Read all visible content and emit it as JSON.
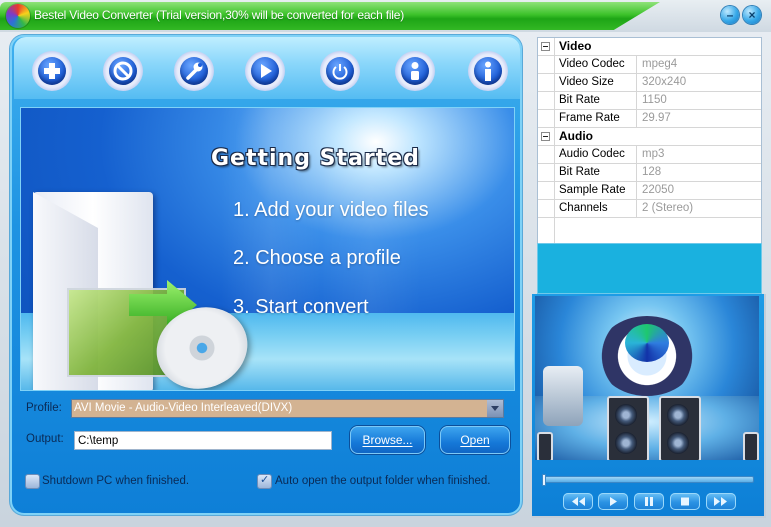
{
  "window": {
    "title": "Bestel Video Converter  (Trial version,30% will be converted for each file)",
    "minimize_glyph": "–",
    "close_glyph": "×"
  },
  "toolbar": {
    "buttons": [
      {
        "name": "add-files",
        "icon": "plus-icon"
      },
      {
        "name": "remove",
        "icon": "prohibit-icon"
      },
      {
        "name": "settings",
        "icon": "wrench-icon"
      },
      {
        "name": "convert",
        "icon": "play-icon"
      },
      {
        "name": "stop",
        "icon": "power-icon"
      },
      {
        "name": "about",
        "icon": "person-icon"
      },
      {
        "name": "info",
        "icon": "info-icon"
      }
    ]
  },
  "banner": {
    "title": "Getting Started",
    "steps": [
      "1. Add your video files",
      "2. Choose a profile",
      "3. Start convert"
    ]
  },
  "form": {
    "profile_label": "Profile:",
    "profile_value": "AVI Movie - Audio-Video Interleaved(DIVX)",
    "output_label": "Output:",
    "output_value": "C:\\temp",
    "browse_label": "Browse...",
    "open_label": "Open",
    "shutdown_label": "Shutdown PC when finished.",
    "shutdown_checked": false,
    "autoopen_label": "Auto open the output folder when finished.",
    "autoopen_checked": true
  },
  "properties": {
    "video": {
      "group": "Video",
      "rows": [
        {
          "name": "Video Codec",
          "value": "mpeg4"
        },
        {
          "name": "Video Size",
          "value": "320x240"
        },
        {
          "name": "Bit Rate",
          "value": "1150"
        },
        {
          "name": "Frame Rate",
          "value": "29.97"
        }
      ]
    },
    "audio": {
      "group": "Audio",
      "rows": [
        {
          "name": "Audio Codec",
          "value": "mp3"
        },
        {
          "name": "Bit Rate",
          "value": "128"
        },
        {
          "name": "Sample Rate",
          "value": "22050"
        },
        {
          "name": "Channels",
          "value": "2 (Stereo)"
        }
      ]
    }
  },
  "player": {
    "progress": 0,
    "buttons": [
      "rewind",
      "play",
      "pause",
      "stop",
      "fast-forward"
    ]
  }
}
